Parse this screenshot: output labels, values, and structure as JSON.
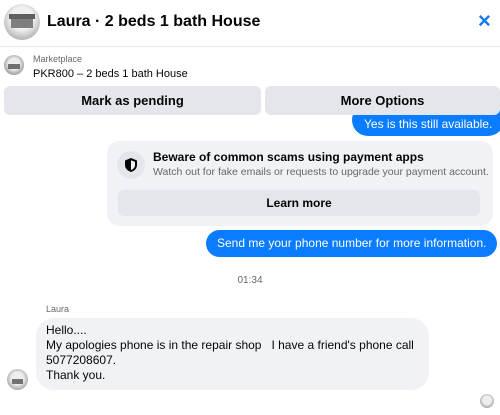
{
  "header": {
    "title": "Laura · 2 beds 1 bath House",
    "close_symbol": "×",
    "avatar_icon": "house-photo-avatar",
    "close_icon": "close-icon"
  },
  "listing": {
    "source": "Marketplace",
    "title": "PKR800 – 2 beds 1 bath House"
  },
  "actions": {
    "pending_label": "Mark as pending",
    "more_label": "More Options"
  },
  "messages": {
    "outgoing_top": "Yes is this still available.",
    "scam_notice": {
      "icon": "shield-icon",
      "title": "Beware of common scams using payment apps",
      "description": "Watch out for fake emails or requests to upgrade your payment account.",
      "button_label": "Learn more"
    },
    "outgoing_phone": "Send me your phone number for more information.",
    "timestamp": "01:34",
    "incoming": {
      "sender": "Laura",
      "lines": [
        "Hello....",
        "My apologies phone is in the repair shop   I have a friend's phone call",
        "5077208607.",
        "Thank you."
      ]
    }
  },
  "colors": {
    "accent": "#0a7cff",
    "button_bg": "#e4e6eb",
    "bubble_bg": "#f0f2f5",
    "secondary_text": "#65676b"
  }
}
